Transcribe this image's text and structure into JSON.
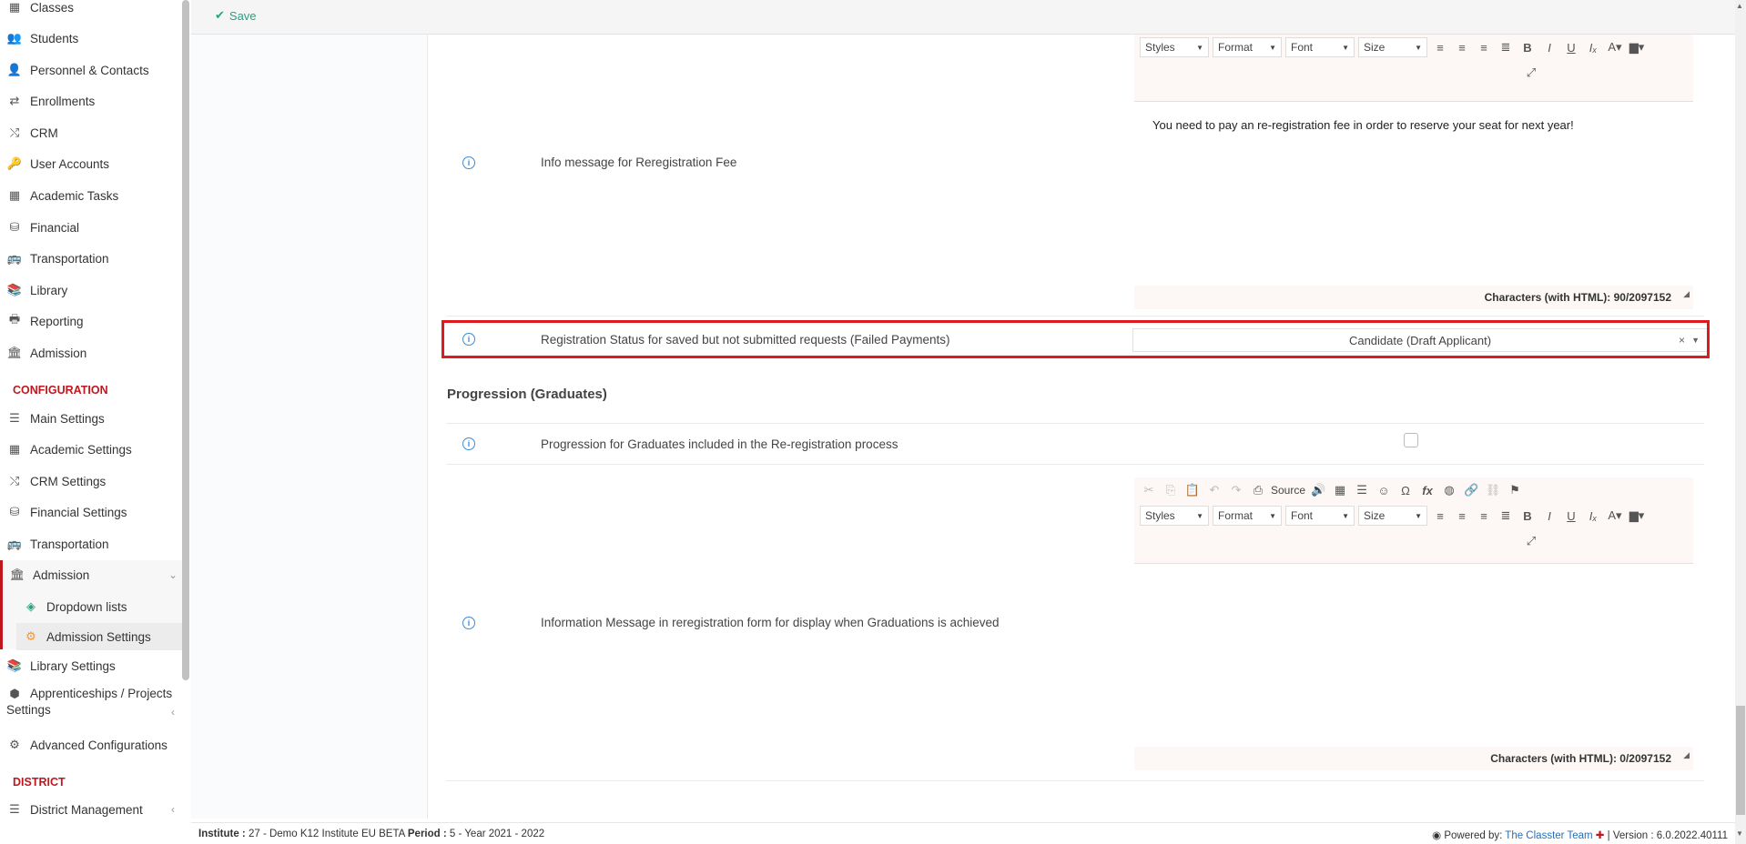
{
  "sidebar": {
    "items": [
      {
        "label": "Classes",
        "icon": "classes-icon"
      },
      {
        "label": "Students",
        "icon": "students-icon"
      },
      {
        "label": "Personnel & Contacts",
        "icon": "personnel-icon"
      },
      {
        "label": "Enrollments",
        "icon": "enrollments-icon"
      },
      {
        "label": "CRM",
        "icon": "crm-icon"
      },
      {
        "label": "User Accounts",
        "icon": "key-icon"
      },
      {
        "label": "Academic Tasks",
        "icon": "grid-icon"
      },
      {
        "label": "Financial",
        "icon": "coins-icon"
      },
      {
        "label": "Transportation",
        "icon": "bus-icon"
      },
      {
        "label": "Library",
        "icon": "books-icon"
      },
      {
        "label": "Reporting",
        "icon": "printer-icon"
      },
      {
        "label": "Admission",
        "icon": "bank-icon"
      }
    ],
    "config_heading": "CONFIGURATION",
    "config_items": [
      {
        "label": "Main Settings",
        "icon": "sliders-icon"
      },
      {
        "label": "Academic Settings",
        "icon": "classes-icon"
      },
      {
        "label": "CRM Settings",
        "icon": "crm-icon"
      },
      {
        "label": "Financial Settings",
        "icon": "coins-icon"
      },
      {
        "label": "Transportation",
        "icon": "bus-icon"
      },
      {
        "label": "Admission",
        "icon": "bank-icon"
      },
      {
        "label": "Dropdown lists",
        "icon": "layers-icon"
      },
      {
        "label": "Admission Settings",
        "icon": "gear-icon"
      },
      {
        "label": "Library Settings",
        "icon": "books-icon"
      },
      {
        "label": "Apprenticeships / Projects",
        "label2": "Settings",
        "icon": "cube-icon"
      },
      {
        "label": "Advanced Configurations",
        "icon": "gears-icon"
      }
    ],
    "district_heading": "DISTRICT",
    "district_items": [
      {
        "label": "District Management",
        "icon": "menu-icon"
      }
    ]
  },
  "toolbar": {
    "save_label": "Save"
  },
  "rows": {
    "reg_fee": {
      "label": "Info message for Reregistration Fee",
      "content": "You need to pay an re-registration fee in order to reserve your seat for next year!",
      "char_count": "Characters (with HTML): 90/2097152"
    },
    "status": {
      "label": "Registration Status for saved but not submitted requests (Failed Payments)",
      "value": "Candidate (Draft Applicant)"
    },
    "section_title": "Progression (Graduates)",
    "progression": {
      "label": "Progression for Graduates included in the Re-registration process"
    },
    "grad_message": {
      "label": "Information Message in reregistration form for display when Graduations is achieved",
      "char_count": "Characters (with HTML): 0/2097152"
    }
  },
  "editor": {
    "source_label": "Source",
    "styles": "Styles",
    "format": "Format",
    "font": "Font",
    "size": "Size"
  },
  "footer": {
    "institute_label": "Institute :",
    "institute_value": "27 - Demo K12 Institute EU BETA",
    "period_label": "Period :",
    "period_value": "5 - Year 2021 - 2022",
    "powered_label": "Powered by:",
    "powered_link": "The Classter Team",
    "version": "| Version : 6.0.2022.40111"
  },
  "colors": {
    "accent": "#c0171f",
    "save": "#27a27f",
    "info": "#3b8bd1",
    "highlight": "#e0191f"
  }
}
